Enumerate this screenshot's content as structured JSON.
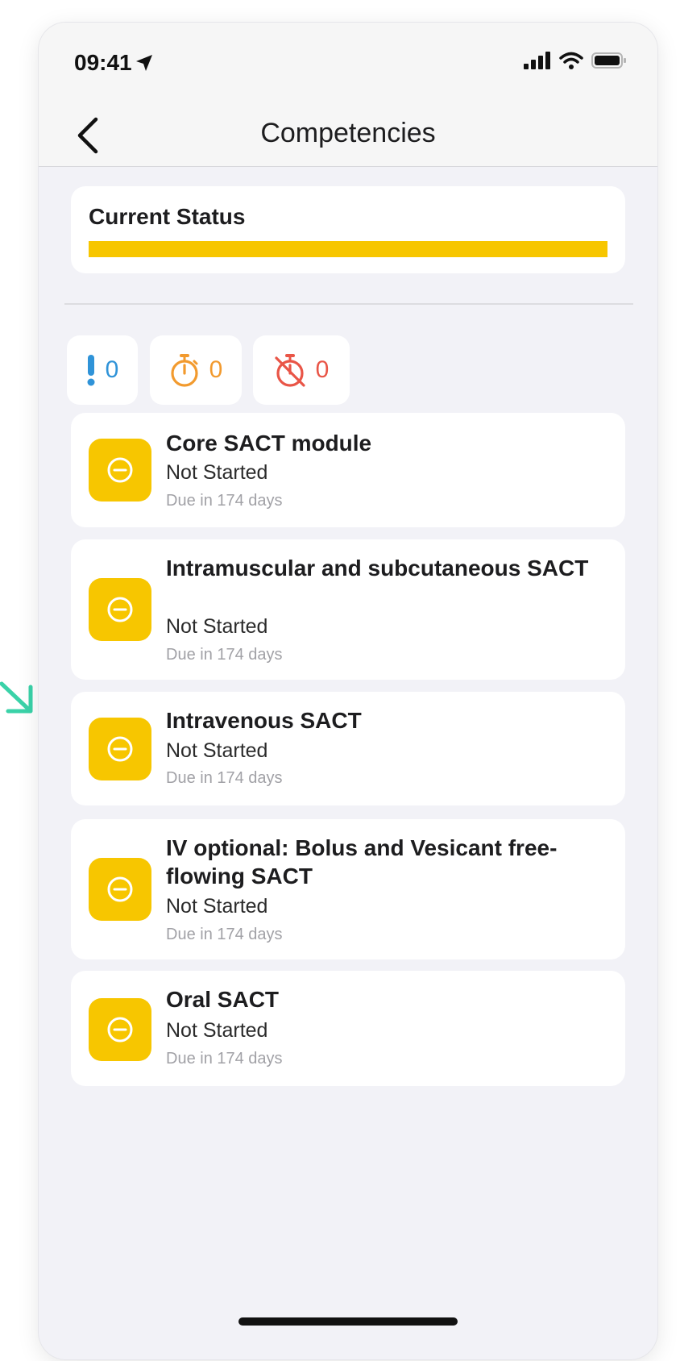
{
  "status_bar": {
    "time": "09:41",
    "icons": [
      "location-arrow-icon",
      "signal-bars-icon",
      "wifi-icon",
      "battery-icon"
    ]
  },
  "nav": {
    "title": "Competencies",
    "back_icon": "chevron-left-icon"
  },
  "current_status": {
    "label": "Current Status",
    "progress_fraction": 1.0,
    "color": "#f7c600"
  },
  "counters": [
    {
      "icon": "exclamation-icon",
      "value": "0",
      "color": "#2f93d8"
    },
    {
      "icon": "stopwatch-icon",
      "value": "0",
      "color": "#f29a2e"
    },
    {
      "icon": "stopwatch-off-icon",
      "value": "0",
      "color": "#e95547"
    }
  ],
  "competencies": [
    {
      "title": "Core SACT module",
      "status": "Not Started",
      "due": "Due in 174 days",
      "icon": "minus-circle-icon"
    },
    {
      "title": "Intramuscular and subcutaneous SACT",
      "status": "Not Started",
      "due": "Due in 174 days",
      "icon": "minus-circle-icon"
    },
    {
      "title": "Intravenous SACT",
      "status": "Not Started",
      "due": "Due in 174 days",
      "icon": "minus-circle-icon"
    },
    {
      "title": "IV optional: Bolus and Vesicant free-flowing SACT",
      "status": "Not Started",
      "due": "Due in 174 days",
      "icon": "minus-circle-icon"
    },
    {
      "title": "Oral SACT",
      "status": "Not Started",
      "due": "Due in 174 days",
      "icon": "minus-circle-icon"
    }
  ],
  "colors": {
    "accent_yellow": "#f7c600",
    "background": "#f2f2f7",
    "card": "#ffffff",
    "decoration_teal": "#3ad2a8"
  }
}
